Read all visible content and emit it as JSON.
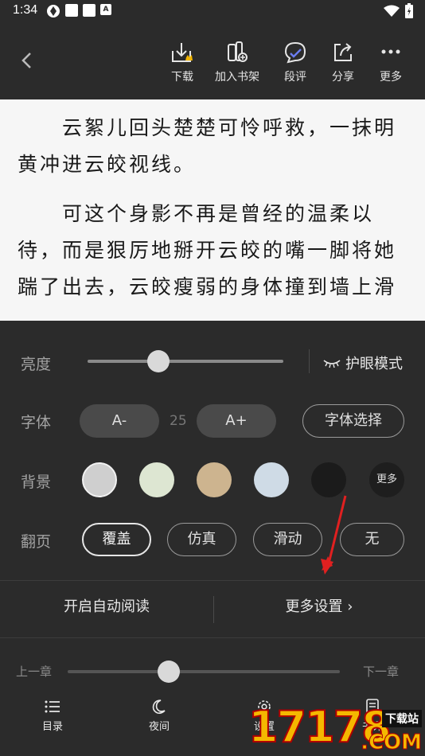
{
  "status_bar": {
    "time": "1:34",
    "notif_letter": "A"
  },
  "top_bar": {
    "actions": [
      {
        "label": "下载",
        "icon": "download-icon"
      },
      {
        "label": "加入书架",
        "icon": "bookshelf-add-icon"
      },
      {
        "label": "段评",
        "icon": "comment-icon"
      },
      {
        "label": "分享",
        "icon": "share-icon"
      },
      {
        "label": "更多",
        "icon": "more-dots-icon"
      }
    ]
  },
  "reader": {
    "paragraphs": [
      "云絮儿回头楚楚可怜呼救，一抹明黄冲进云皎视线。",
      "可这个身影不再是曾经的温柔以待，而是狠厉地掰开云皎的嘴一脚将她踹了出去，云皎瘦弱的身体撞到墙上滑"
    ]
  },
  "settings": {
    "brightness": {
      "label": "亮度",
      "level": 0.36,
      "eye_mode": "护眼模式"
    },
    "font": {
      "label": "字体",
      "decrease": "A-",
      "size": "25",
      "increase": "A+",
      "choose": "字体选择"
    },
    "background": {
      "label": "背景",
      "swatches": [
        "#cfcfcf",
        "#dde6d2",
        "#cdb48f",
        "#cfdbe6",
        "#1b1b1b"
      ],
      "more": "更多"
    },
    "page_turn": {
      "label": "翻页",
      "options": [
        "覆盖",
        "仿真",
        "滑动",
        "无"
      ],
      "selected": "覆盖"
    },
    "auto_read": "开启自动阅读",
    "more_settings": "更多设置 ›"
  },
  "chapter": {
    "prev": "上一章",
    "next": "下一章",
    "progress": 0.37
  },
  "bottom_nav": [
    {
      "label": "目录",
      "icon": "list-icon"
    },
    {
      "label": "夜间",
      "icon": "moon-icon"
    },
    {
      "label": "设置",
      "icon": "gear-icon"
    },
    {
      "label": "书评",
      "icon": "note-icon"
    }
  ],
  "watermark": {
    "number": "17178",
    "com": ".COM",
    "tag": "下载站"
  },
  "colors": {
    "panel_bg": "#2b2b2b",
    "reader_bg": "#f6f6f6",
    "annotation_arrow": "#e02020"
  }
}
